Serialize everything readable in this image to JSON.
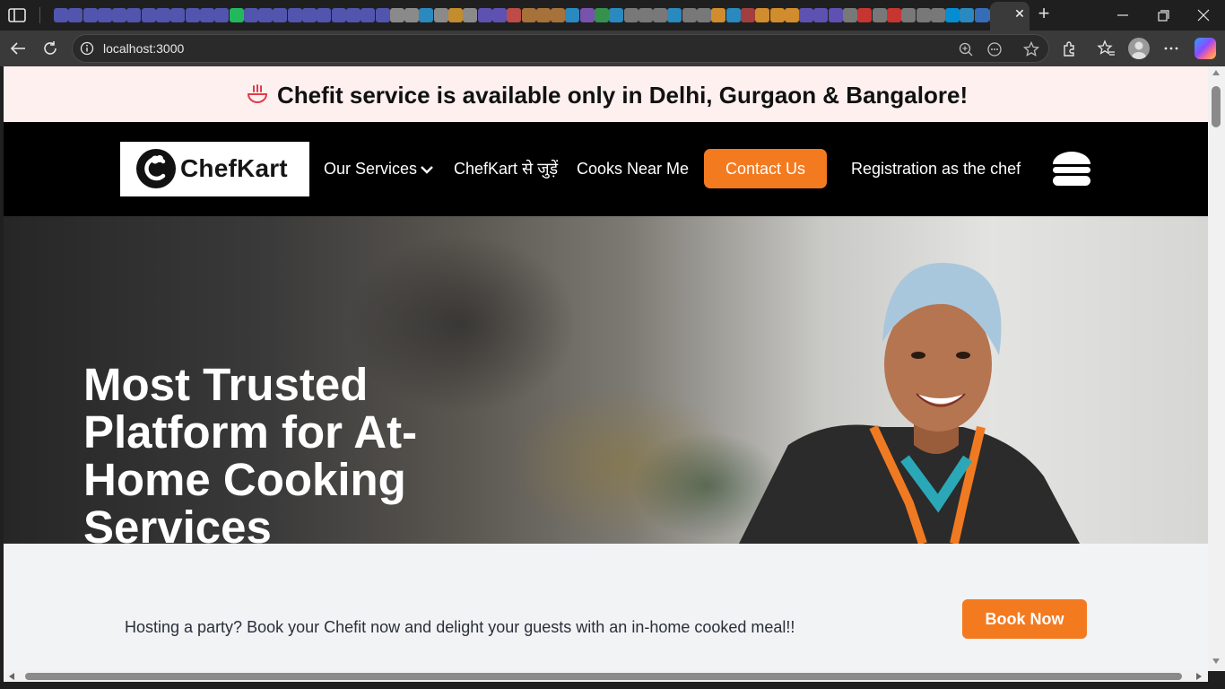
{
  "browser": {
    "url": "localhost:3000",
    "tab_favicon_colors": [
      "#5b5fc7",
      "#5b5fc7",
      "#5b5fc7",
      "#5b5fc7",
      "#5b5fc7",
      "#5b5fc7",
      "#5b5fc7",
      "#5b5fc7",
      "#5b5fc7",
      "#5b5fc7",
      "#5b5fc7",
      "#5b5fc7",
      "#25d366",
      "#5b5fc7",
      "#5b5fc7",
      "#5b5fc7",
      "#5b5fc7",
      "#5b5fc7",
      "#5b5fc7",
      "#5b5fc7",
      "#5b5fc7",
      "#5b5fc7",
      "#5b5fc7",
      "#9e9e9e",
      "#9e9e9e",
      "#2d9cdb",
      "#9e9e9e",
      "#e0a030",
      "#9e9e9e",
      "#6a5acd",
      "#6a5acd",
      "#d9534f",
      "#c08040",
      "#c08040",
      "#c08040",
      "#2d9cdb",
      "#8a5cc7",
      "#3aa655",
      "#2d9cdb",
      "#888888",
      "#888888",
      "#888888",
      "#2d9cdb",
      "#888888",
      "#888888",
      "#f0a030",
      "#2d9cdb",
      "#bb4444",
      "#f0a030",
      "#f0a030",
      "#f0a030",
      "#6a5acd",
      "#6a5acd",
      "#6a5acd",
      "#888888",
      "#e53935",
      "#888888",
      "#e53935",
      "#888888",
      "#888888",
      "#888888",
      "#00a1f1",
      "#2d9cdb",
      "#3a7bd5",
      "#3a7bd5",
      "#888888",
      "#888888"
    ],
    "icons": {
      "sidebar": "tab-actions-icon",
      "back": "back-arrow-icon",
      "reload": "reload-icon",
      "info": "site-info-icon",
      "zoom": "zoom-icon",
      "reading": "reading-mode-icon",
      "favorite": "star-icon",
      "extensions": "extensions-icon",
      "favorites": "favorites-icon",
      "profile": "profile-avatar",
      "more": "more-icon",
      "copilot": "copilot-icon"
    }
  },
  "announcement": {
    "text": "Chefit service is available only in Delhi, Gurgaon & Bangalore!",
    "icon": "cooking-bowl-icon"
  },
  "navbar": {
    "logo_text": "ChefKart",
    "links": {
      "our_services": "Our Services",
      "join": "ChefKart से जुड़ें",
      "cooks_near_me": "Cooks Near Me",
      "contact": "Contact Us",
      "registration": "Registration as the chef"
    },
    "menu_icon": "hamburger-menu-icon"
  },
  "hero": {
    "title": "Most Trusted Platform for At-Home Cooking Services"
  },
  "promo": {
    "text": "Hosting a party? Book your Chefit now and delight your guests with an in-home cooked meal!!",
    "button": "Book Now"
  },
  "colors": {
    "accent": "#f47a20",
    "announce_bg": "#fdf0ef",
    "nav_bg": "#000000",
    "promo_bg": "#f2f3f5"
  }
}
